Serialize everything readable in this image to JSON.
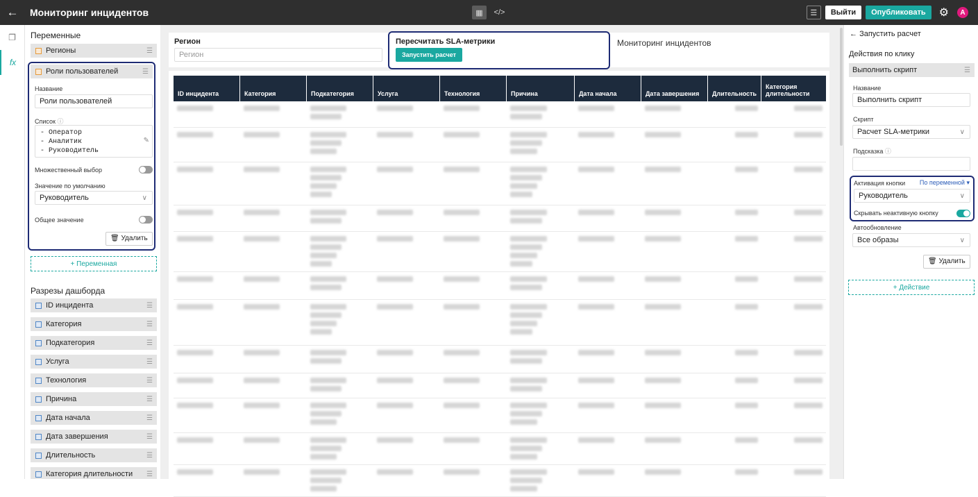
{
  "topbar": {
    "title": "Мониторинг инцидентов",
    "exit": "Выйти",
    "publish": "Опубликовать",
    "avatar": "A",
    "icons": [
      "back-arrow-icon",
      "grid-view-icon",
      "code-icon",
      "tree-icon",
      "gear-icon"
    ]
  },
  "left": {
    "variables_title": "Переменные",
    "var1": "Регионы",
    "var2": "Роли пользователей",
    "card": {
      "name_label": "Название",
      "name_value": "Роли пользователей",
      "list_label": "Список",
      "list_lines": [
        "-  Оператор",
        "-  Аналитик",
        "-  Руководитель"
      ],
      "multi_label": "Множественный выбор",
      "default_label": "Значение по умолчанию",
      "default_value": "Руководитель",
      "shared_label": "Общее значение",
      "delete": "Удалить"
    },
    "add_var": "Переменная",
    "slices_title": "Разрезы дашборда",
    "slices": [
      "ID инцидента",
      "Категория",
      "Подкатегория",
      "Услуга",
      "Технология",
      "Причина",
      "Дата начала",
      "Дата завершения",
      "Длительность",
      "Категория длительности"
    ]
  },
  "canvas": {
    "region_label": "Регион",
    "region_placeholder": "Регион",
    "sla_title": "Пересчитать SLA-метрики",
    "sla_button": "Запустить расчет",
    "text_widget": "Мониторинг инцидентов",
    "columns": [
      "ID инцидента",
      "Категория",
      "Подкатегория",
      "Услуга",
      "Технология",
      "Причина",
      "Дата начала",
      "Дата завершения",
      "Длительность",
      "Категория длительности"
    ]
  },
  "right": {
    "back_title": "Запустить расчет",
    "actions_title": "Действия по клику",
    "action_item": "Выполнить скрипт",
    "name_label": "Название",
    "name_value": "Выполнить скрипт",
    "script_label": "Скрипт",
    "script_value": "Расчет SLA-метрики",
    "hint_label": "Подсказка",
    "activation_label": "Активация кнопки",
    "activation_mode": "По переменной",
    "activation_value": "Руководитель",
    "hide_label": "Скрывать неактивную кнопку",
    "autoupdate_label": "Автообновление",
    "autoupdate_value": "Все образы",
    "delete": "Удалить",
    "add_action": "Действие"
  },
  "colors": {
    "accent": "#1aa8a0",
    "header": "#2f2f2f",
    "table_header": "#1d2b3d",
    "highlight": "#1e2b74"
  }
}
